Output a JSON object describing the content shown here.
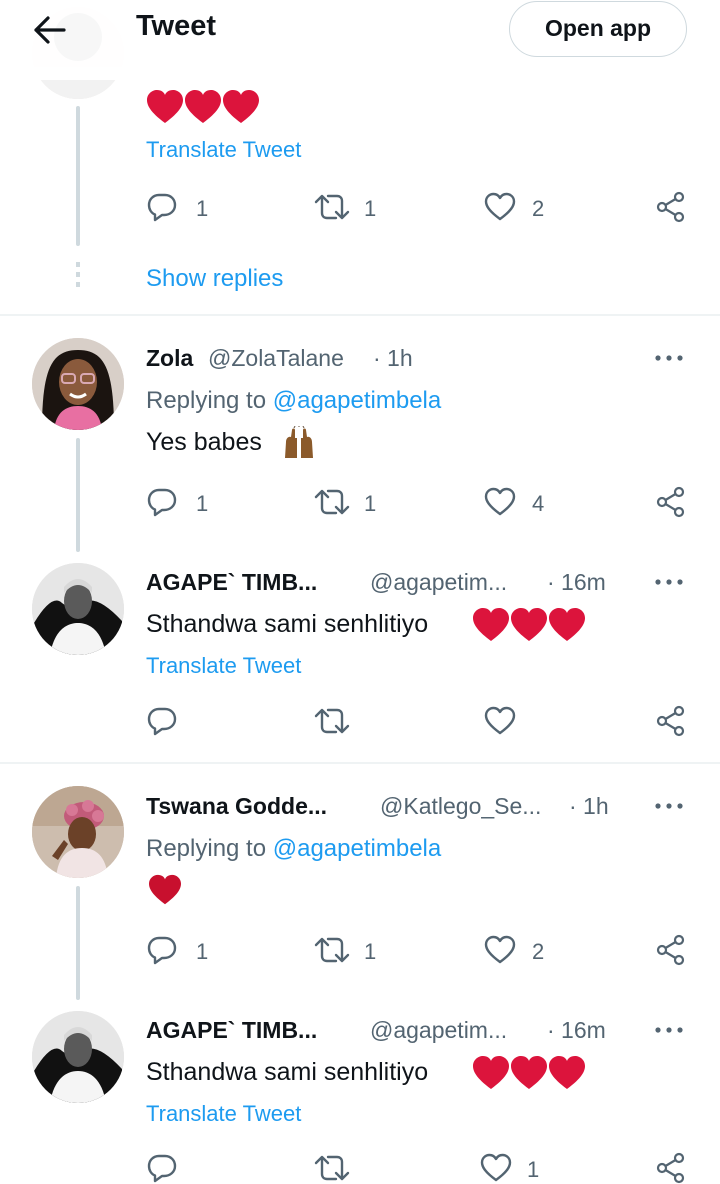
{
  "header": {
    "title": "Tweet",
    "open_app": "Open app"
  },
  "top_tweet": {
    "translate": "Translate Tweet",
    "replies": "1",
    "retweets": "1",
    "likes": "2",
    "show_replies": "Show replies"
  },
  "tweets": [
    {
      "name": "Zola",
      "handle": "@ZolaTalane",
      "time": "· 1h",
      "replying_label": "Replying to ",
      "replying_to": "@agapetimbela",
      "text": "Yes babes",
      "replies": "1",
      "retweets": "1",
      "likes": "4"
    },
    {
      "name": "AGAPE` TIMB...",
      "handle": "@agapetim...",
      "time": "· 16m",
      "text": "Sthandwa sami senhlitiyo",
      "translate": "Translate Tweet"
    },
    {
      "name": "Tswana Godde...",
      "handle": "@Katlego_Se...",
      "time": "· 1h",
      "replying_label": "Replying to ",
      "replying_to": "@agapetimbela",
      "replies": "1",
      "retweets": "1",
      "likes": "2"
    },
    {
      "name": "AGAPE` TIMB...",
      "handle": "@agapetim...",
      "time": "· 16m",
      "text": "Sthandwa sami senhlitiyo",
      "translate": "Translate Tweet",
      "likes": "1"
    }
  ],
  "colors": {
    "link": "#1d9bf0",
    "muted": "#536471",
    "heart": "#dc143c",
    "line": "#cfd9de"
  }
}
